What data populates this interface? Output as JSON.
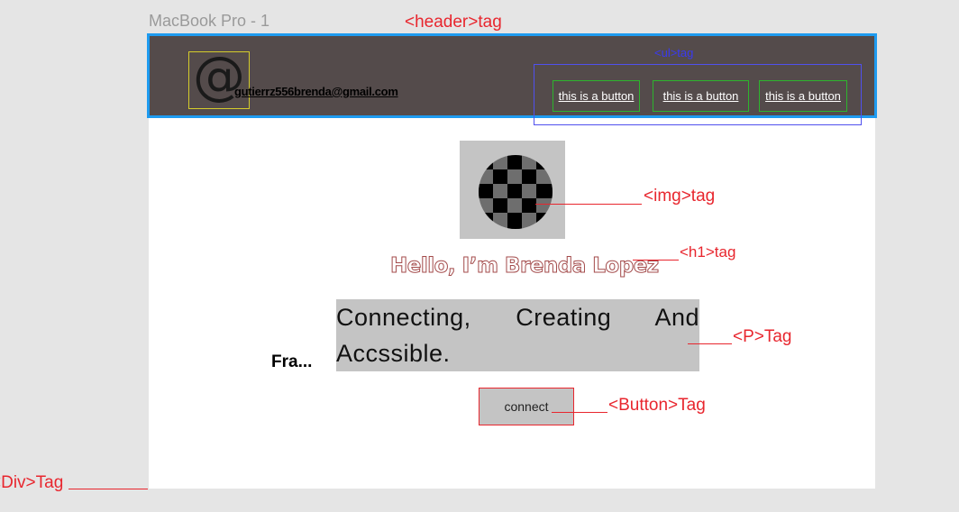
{
  "frame_title": "MacBook Pro - 1",
  "annotations": {
    "header": "<header>tag",
    "ul": "<ul>tag",
    "img": "<img>tag",
    "h1": "<h1>tag",
    "p": "<P>Tag",
    "button": "<Button>Tag",
    "div": "<Div>Tag"
  },
  "header": {
    "at_symbol": "@",
    "email": "gutierrz556brenda@gmail.com",
    "nav_buttons": [
      "this is a button",
      "this is a button",
      "this is a button"
    ]
  },
  "main": {
    "heading": "Hello, I’m Brenda Lopez",
    "paragraph": "Connecting, Creating And Accssible.",
    "side_label": "Fra...",
    "connect_label": "connect"
  },
  "colors": {
    "header_bg": "#544b4b",
    "header_border": "#1e9bf0",
    "annotation_red": "#e8262e",
    "annotation_blue": "#3a3af0",
    "placeholder_gray": "#c4c4c4"
  },
  "icons": {
    "image": "checkered-circle-icon"
  }
}
